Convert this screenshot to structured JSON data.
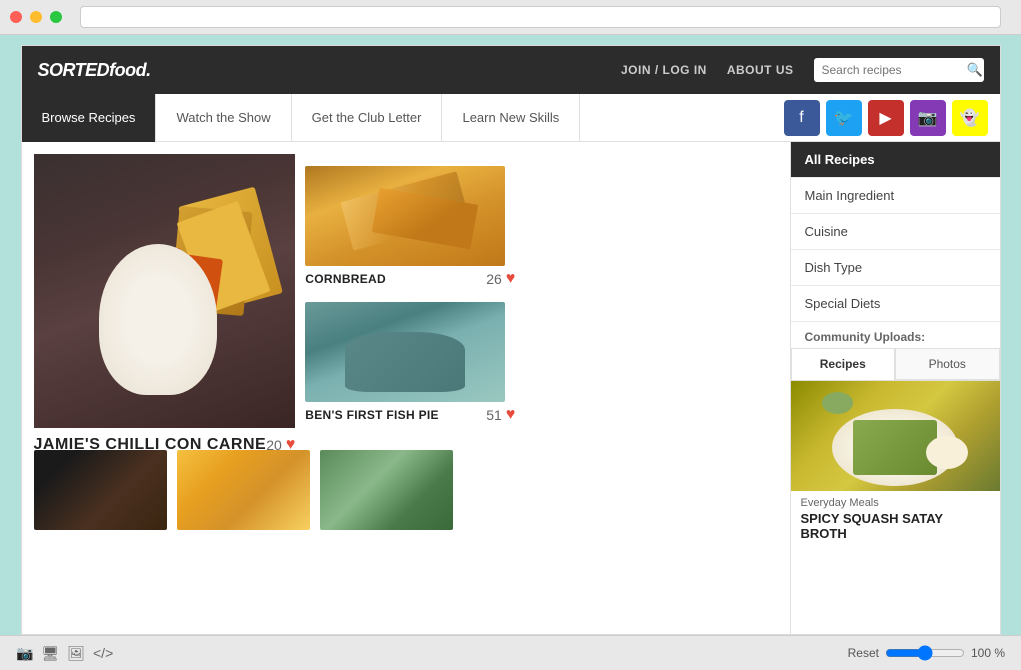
{
  "browser": {
    "zoom": "100 %",
    "reset_label": "Reset"
  },
  "header": {
    "logo": "SORTEDfood.",
    "nav": {
      "join_login": "JOIN / LOG IN",
      "about_us": "ABOUT US"
    },
    "search": {
      "placeholder": "Search recipes"
    }
  },
  "subnav": {
    "items": [
      {
        "label": "Browse Recipes",
        "active": true
      },
      {
        "label": "Watch the Show",
        "active": false
      },
      {
        "label": "Get the Club Letter",
        "active": false
      },
      {
        "label": "Learn New Skills",
        "active": false
      }
    ]
  },
  "social": [
    {
      "name": "facebook",
      "symbol": "f",
      "class": "social-fb"
    },
    {
      "name": "twitter",
      "symbol": "🐦",
      "class": "social-tw"
    },
    {
      "name": "youtube",
      "symbol": "▶",
      "class": "social-yt"
    },
    {
      "name": "instagram",
      "symbol": "📷",
      "class": "social-ig"
    },
    {
      "name": "snapchat",
      "symbol": "👻",
      "class": "social-sc"
    }
  ],
  "recipes": {
    "featured": {
      "title": "JAMIE'S CHILLI CON CARNE",
      "likes": "20"
    },
    "small_cards": [
      {
        "title": "CORNBREAD",
        "likes": "26"
      },
      {
        "title": "BEN'S FIRST FISH PIE",
        "likes": "51"
      }
    ]
  },
  "sidebar": {
    "filter_items": [
      {
        "label": "All Recipes",
        "active": true
      },
      {
        "label": "Main Ingredient",
        "active": false
      },
      {
        "label": "Cuisine",
        "active": false
      },
      {
        "label": "Dish Type",
        "active": false
      },
      {
        "label": "Special Diets",
        "active": false
      }
    ],
    "community": {
      "label": "Community Uploads:",
      "tabs": [
        {
          "label": "Recipes",
          "active": true
        },
        {
          "label": "Photos",
          "active": false
        }
      ]
    },
    "featured_recipe": {
      "category": "Everyday Meals",
      "title": "SPICY SQUASH SATAY BROTH"
    }
  }
}
